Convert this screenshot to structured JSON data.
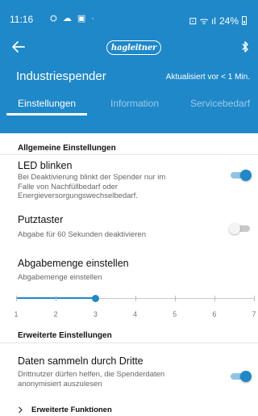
{
  "status_bar": {
    "time": "11:16",
    "notifications": "⛭ ☁ ▣ ·",
    "signal": "⊡ ᯤ ıl",
    "battery": "24%"
  },
  "header": {
    "logo_text": "hagleitner",
    "title": "Industriespender",
    "updated": "Aktualisiert vor < 1 Min."
  },
  "tabs": [
    {
      "label": "Einstellungen",
      "active": true
    },
    {
      "label": "Information",
      "active": false
    },
    {
      "label": "Servicebedarf",
      "active": false
    }
  ],
  "sections": {
    "general": "Allgemeine Einstellungen",
    "advanced": "Erweiterte Einstellungen"
  },
  "settings": {
    "led": {
      "title": "LED blinken",
      "desc": "Bei Deaktivierung blinkt der Spender nur im Falle von Nachfüllbedarf oder Energieversorgungswechselbedarf.",
      "enabled": true
    },
    "putztaster": {
      "title": "Putztaster",
      "desc": "Abgabe für 60 Sekunden deaktivieren",
      "enabled": false
    },
    "amount": {
      "title": "Abgabemenge einstellen",
      "desc": "Abgabemenge einstellen",
      "value": 3,
      "min": 1,
      "max": 7,
      "ticks": [
        "1",
        "2",
        "3",
        "4",
        "5",
        "6",
        "7"
      ]
    },
    "third_party": {
      "title": "Daten sammeln durch Dritte",
      "desc": "Drittnutzer dürfen helfen, die Spenderdaten anonymisiert auszulesen",
      "enabled": true
    }
  },
  "expand": {
    "label": "Erweiterte Funktionen"
  },
  "colors": {
    "primary": "#1f88c9",
    "toggle_track_on": "#90c4e6"
  },
  "icons": {
    "back": "arrow-left-icon",
    "bluetooth": "bluetooth-icon",
    "chevron": "chevron-right-icon"
  }
}
